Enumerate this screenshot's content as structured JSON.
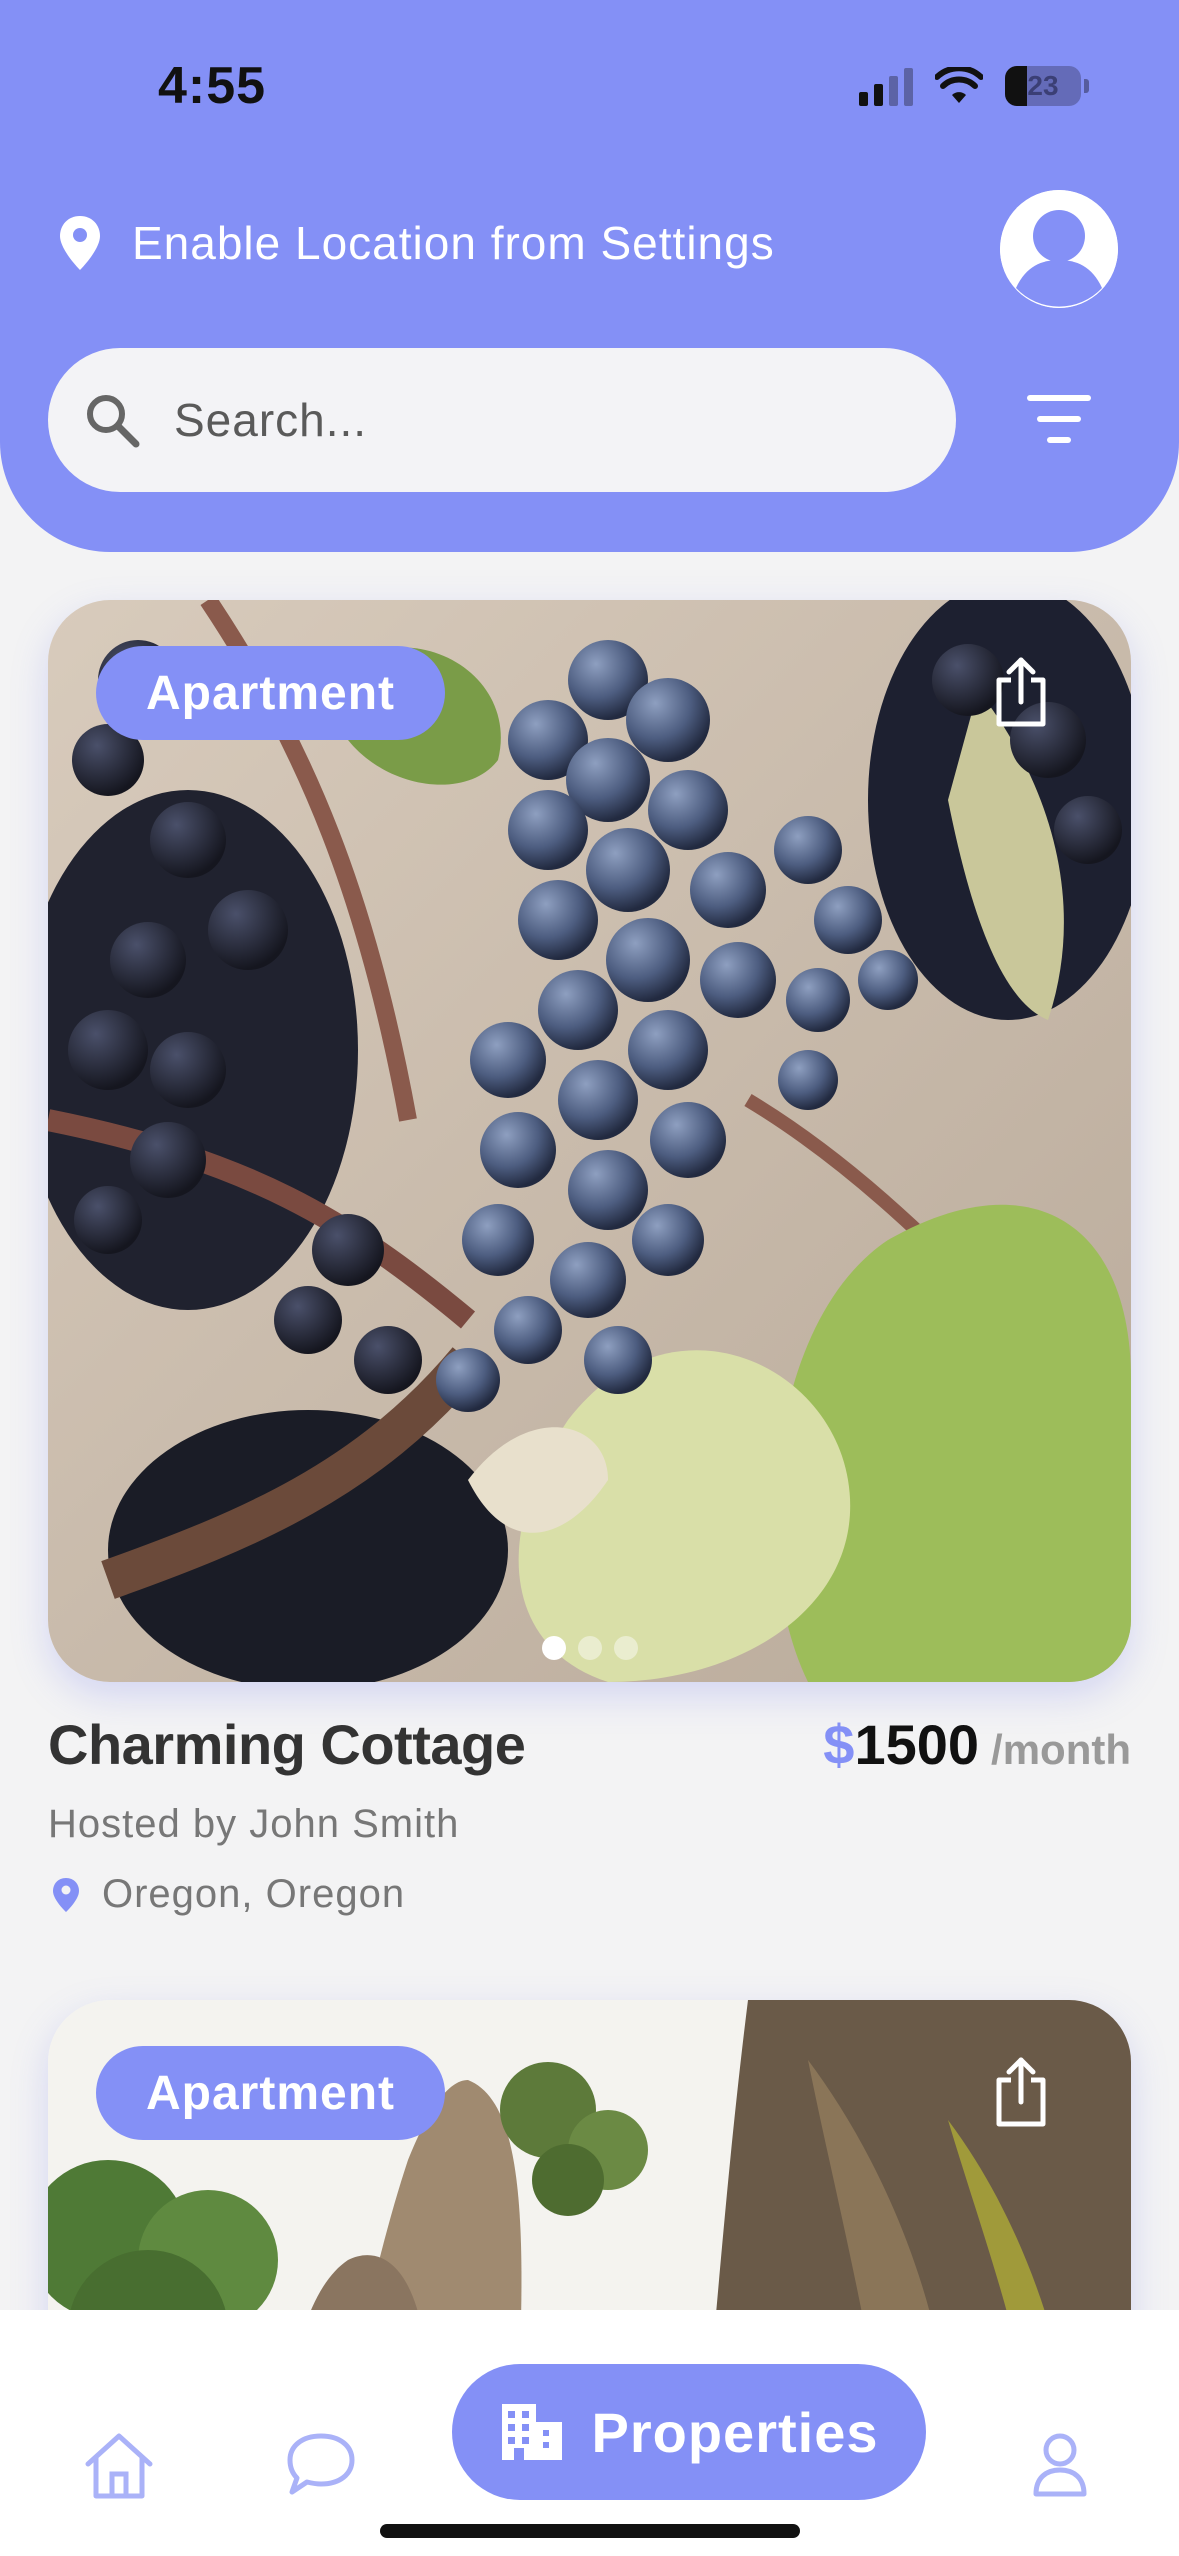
{
  "status_bar": {
    "time": "4:55",
    "battery": "23"
  },
  "header": {
    "location_text": "Enable Location from Settings",
    "search_placeholder": "Search..."
  },
  "listings": [
    {
      "type": "Apartment",
      "title": "Charming Cottage",
      "currency": "$",
      "price": "1500",
      "period": "/month",
      "host": "Hosted by John Smith",
      "location": "Oregon, Oregon",
      "image": "grapes-on-vine",
      "dots": 3,
      "active_dot": 0
    },
    {
      "type": "Apartment",
      "image": "rock-formations"
    }
  ],
  "bottom_nav": {
    "items": [
      "home-icon",
      "chat-icon",
      "Properties",
      "profile-icon"
    ],
    "active_label": "Properties"
  },
  "colors": {
    "accent": "#8490f6",
    "background": "#f3f3f4"
  }
}
